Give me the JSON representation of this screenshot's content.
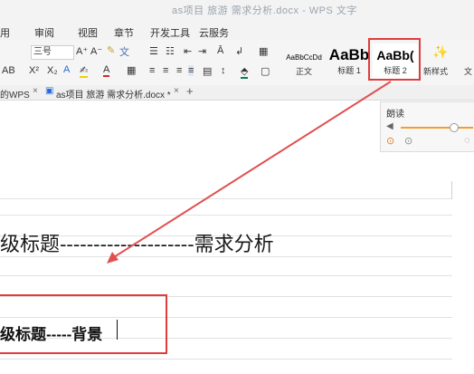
{
  "title": "as项目 旅游 需求分析.docx - WPS 文字",
  "menu": [
    "用",
    "审阅",
    "视图",
    "章节",
    "开发工具",
    "云服务"
  ],
  "ribbon": {
    "font_size": "三号",
    "font_name": "AB",
    "grow_font": "A⁺",
    "shrink_font": "A⁻",
    "superscript": "X²",
    "subscript": "X₂",
    "styles": [
      {
        "sample": "AaBbCcDd",
        "label": "正文"
      },
      {
        "sample": "AaBb",
        "label": "标题 1"
      },
      {
        "sample": "AaBb(",
        "label": "标题 2"
      }
    ],
    "new_style": "新样式",
    "extra": "文"
  },
  "tabs": {
    "partial_left": "的WPS",
    "doc_tab": "as项目 旅游 需求分析.docx *",
    "new_tab": "+"
  },
  "panel": {
    "title": "朗读"
  },
  "document": {
    "heading1": "级标题--------------------需求分析",
    "heading2": "级标题-----背景"
  },
  "colors": {
    "highlight_red": "#e03c3c",
    "arrow_red": "#e05050"
  }
}
